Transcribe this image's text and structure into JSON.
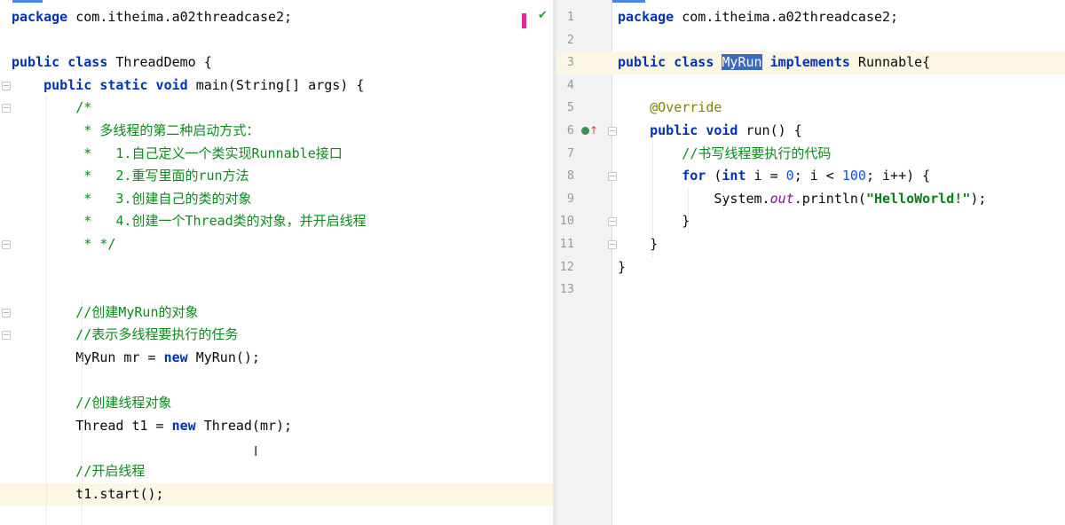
{
  "left_editor": {
    "lines": [
      {
        "tokens": [
          {
            "t": "package",
            "c": "kw"
          },
          {
            "t": " com.itheima.a02threadcase2;",
            "c": ""
          }
        ]
      },
      {
        "tokens": []
      },
      {
        "tokens": [
          {
            "t": "public class",
            "c": "kw"
          },
          {
            "t": " ThreadDemo {",
            "c": ""
          }
        ]
      },
      {
        "tokens": [
          {
            "t": "    "
          },
          {
            "t": "public static void",
            "c": "kw"
          },
          {
            "t": " main(String[] args) {",
            "c": ""
          }
        ]
      },
      {
        "tokens": [
          {
            "t": "        "
          },
          {
            "t": "/*",
            "c": "cm"
          }
        ]
      },
      {
        "tokens": [
          {
            "t": "         "
          },
          {
            "t": "* ",
            "c": "cm"
          },
          {
            "t": "多线程的第二种启动方式：",
            "c": "cmc"
          }
        ]
      },
      {
        "tokens": [
          {
            "t": "         "
          },
          {
            "t": "*   1.",
            "c": "cm"
          },
          {
            "t": "自己定义一个类实现",
            "c": "cmc"
          },
          {
            "t": "Runnable",
            "c": "cm"
          },
          {
            "t": "接口",
            "c": "cmc"
          }
        ]
      },
      {
        "tokens": [
          {
            "t": "         "
          },
          {
            "t": "*   2.",
            "c": "cm"
          },
          {
            "t": "重写里面的",
            "c": "cmc"
          },
          {
            "t": "run",
            "c": "cm"
          },
          {
            "t": "方法",
            "c": "cmc"
          }
        ]
      },
      {
        "tokens": [
          {
            "t": "         "
          },
          {
            "t": "*   3.",
            "c": "cm"
          },
          {
            "t": "创建自己的类的对象",
            "c": "cmc"
          }
        ]
      },
      {
        "tokens": [
          {
            "t": "         "
          },
          {
            "t": "*   4.",
            "c": "cm"
          },
          {
            "t": "创建一个",
            "c": "cmc"
          },
          {
            "t": "Thread",
            "c": "cm"
          },
          {
            "t": "类的对象，并开启线程",
            "c": "cmc"
          }
        ]
      },
      {
        "tokens": [
          {
            "t": "         "
          },
          {
            "t": "* */",
            "c": "cm"
          }
        ]
      },
      {
        "tokens": []
      },
      {
        "tokens": []
      },
      {
        "tokens": [
          {
            "t": "        "
          },
          {
            "t": "//",
            "c": "cm"
          },
          {
            "t": "创建",
            "c": "cmc"
          },
          {
            "t": "MyRun",
            "c": "cm"
          },
          {
            "t": "的对象",
            "c": "cmc"
          }
        ]
      },
      {
        "tokens": [
          {
            "t": "        "
          },
          {
            "t": "//",
            "c": "cm"
          },
          {
            "t": "表示多线程要执行的任务",
            "c": "cmc"
          }
        ]
      },
      {
        "tokens": [
          {
            "t": "        MyRun mr = "
          },
          {
            "t": "new",
            "c": "kw"
          },
          {
            "t": " MyRun();",
            "c": ""
          }
        ]
      },
      {
        "tokens": []
      },
      {
        "tokens": [
          {
            "t": "        "
          },
          {
            "t": "//",
            "c": "cm"
          },
          {
            "t": "创建线程对象",
            "c": "cmc"
          }
        ]
      },
      {
        "tokens": [
          {
            "t": "        Thread t1 = "
          },
          {
            "t": "new",
            "c": "kw"
          },
          {
            "t": " Thread(mr);",
            "c": ""
          }
        ]
      },
      {
        "tokens": []
      },
      {
        "tokens": [
          {
            "t": "        "
          },
          {
            "t": "//",
            "c": "cm"
          },
          {
            "t": "开启线程",
            "c": "cmc"
          }
        ]
      },
      {
        "tokens": [
          {
            "t": "        t1.start();",
            "c": ""
          }
        ],
        "highlight": true
      },
      {
        "tokens": []
      }
    ]
  },
  "right_editor": {
    "lines": [
      {
        "n": "1",
        "tokens": [
          {
            "t": "package",
            "c": "kw"
          },
          {
            "t": " com.itheima.a02threadcase2;",
            "c": ""
          }
        ]
      },
      {
        "n": "2",
        "tokens": []
      },
      {
        "n": "3",
        "tokens": [
          {
            "t": "public class",
            "c": "kw"
          },
          {
            "t": " "
          },
          {
            "t": "MyRun",
            "c": "selword"
          },
          {
            "t": " "
          },
          {
            "t": "implements",
            "c": "kw"
          },
          {
            "t": " Runnable{",
            "c": ""
          }
        ],
        "highlight": true
      },
      {
        "n": "4",
        "tokens": []
      },
      {
        "n": "5",
        "tokens": [
          {
            "t": "    "
          },
          {
            "t": "@Override",
            "c": "ann"
          }
        ]
      },
      {
        "n": "6",
        "tokens": [
          {
            "t": "    "
          },
          {
            "t": "public void",
            "c": "kw"
          },
          {
            "t": " run() {",
            "c": ""
          }
        ],
        "icon": "implements-method-icon"
      },
      {
        "n": "7",
        "tokens": [
          {
            "t": "        "
          },
          {
            "t": "//",
            "c": "cm"
          },
          {
            "t": "书写线程要执行的代码",
            "c": "cmc"
          }
        ]
      },
      {
        "n": "8",
        "tokens": [
          {
            "t": "        "
          },
          {
            "t": "for",
            "c": "kw"
          },
          {
            "t": " ("
          },
          {
            "t": "int",
            "c": "kw"
          },
          {
            "t": " i = "
          },
          {
            "t": "0",
            "c": "num"
          },
          {
            "t": "; i < "
          },
          {
            "t": "100",
            "c": "num"
          },
          {
            "t": "; i++) {",
            "c": ""
          }
        ]
      },
      {
        "n": "9",
        "tokens": [
          {
            "t": "            System."
          },
          {
            "t": "out",
            "c": "static"
          },
          {
            "t": ".println("
          },
          {
            "t": "\"HelloWorld!\"",
            "c": "str"
          },
          {
            "t": ");",
            "c": ""
          }
        ]
      },
      {
        "n": "10",
        "tokens": [
          {
            "t": "        }",
            "c": ""
          }
        ]
      },
      {
        "n": "11",
        "tokens": [
          {
            "t": "    }",
            "c": ""
          }
        ]
      },
      {
        "n": "12",
        "tokens": [
          {
            "t": "}",
            "c": ""
          }
        ]
      },
      {
        "n": "13",
        "tokens": []
      }
    ]
  },
  "colors": {
    "keyword": "#0033b3",
    "comment": "#0c8a1d",
    "annotation": "#808000",
    "number": "#1750eb",
    "string": "#067d17",
    "static_field": "#871094",
    "selection": "#3a6bbf",
    "current_line": "#fcf7e4",
    "gutter_bg": "#f2f2f2",
    "tab_accent": "#4a86e8"
  },
  "icons": {
    "inspection_ok": "check-icon",
    "text_cursor": "i-beam-cursor-icon",
    "implements": "implements-method-icon",
    "fold": "fold-marker-icon"
  },
  "status": {
    "inspection_glyph": "✔",
    "cursor_glyph": "I"
  }
}
